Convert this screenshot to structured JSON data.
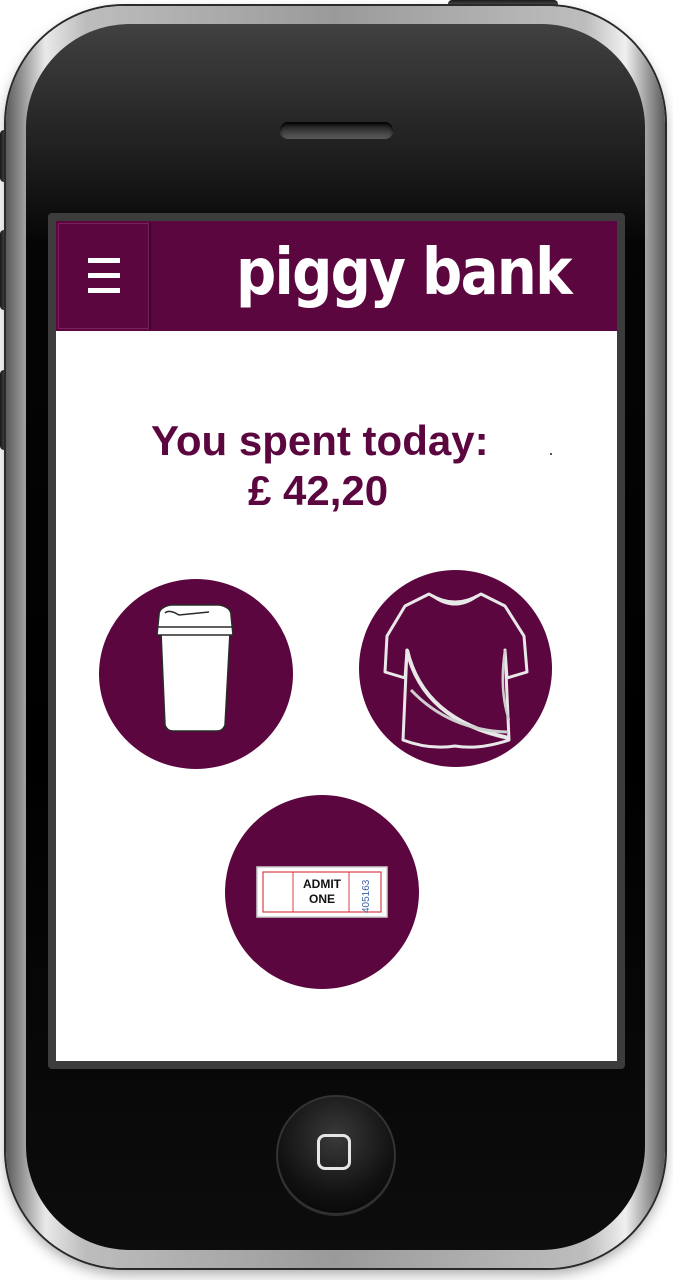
{
  "app": {
    "title": "piggy bank",
    "menu_icon": "hamburger-menu-icon"
  },
  "summary": {
    "label": "You spent today:",
    "amount": "£ 42,20"
  },
  "categories": [
    {
      "icon": "coffee-cup-icon"
    },
    {
      "icon": "t-shirt-icon"
    },
    {
      "icon": "ticket-icon",
      "ticket_line1": "ADMIT",
      "ticket_line2": "ONE",
      "ticket_number": "405163"
    }
  ],
  "colors": {
    "brand": "#5c0640",
    "surface": "#ffffff"
  }
}
